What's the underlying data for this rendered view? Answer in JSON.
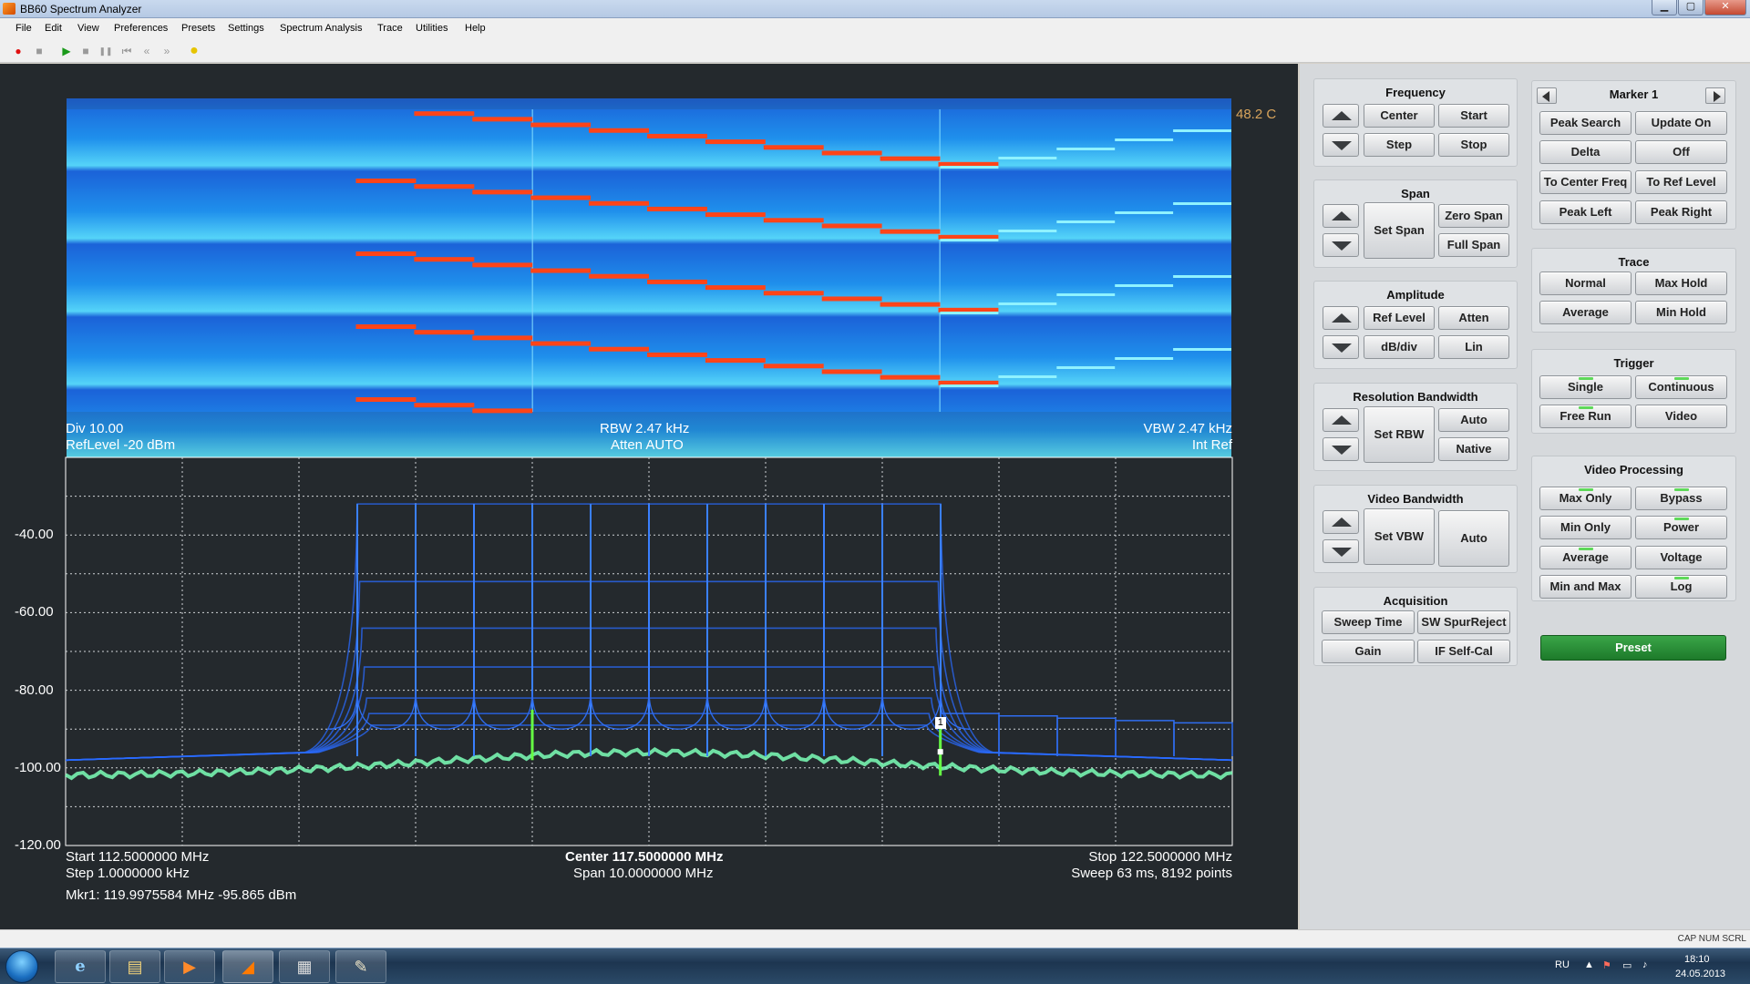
{
  "window": {
    "title": "BB60 Spectrum Analyzer"
  },
  "menu": [
    "File",
    "Edit",
    "View",
    "Preferences",
    "Presets",
    "Settings",
    "Spectrum Analysis",
    "Trace",
    "Utilities",
    "Help"
  ],
  "toolbar": {
    "record_icon": "●",
    "stop_rec_icon": "■",
    "play_icon": "▶",
    "stop_icon": "■",
    "pause_icon": "❚❚",
    "prev_icon": "⏮",
    "rewind_icon": "«",
    "forward_icon": "»",
    "cal_icon": "●"
  },
  "waterfall": {
    "temperature": "48.2 C"
  },
  "plot_info": {
    "div": "Div 10.00",
    "ref_level": "RefLevel -20 dBm",
    "rbw": "RBW 2.47 kHz",
    "atten": "Atten AUTO",
    "vbw": "VBW 2.47 kHz",
    "ref": "Int Ref",
    "start": "Start 112.5000000 MHz",
    "step": "Step 1.0000000 kHz",
    "center": "Center 117.5000000 MHz",
    "span": "Span 10.0000000 MHz",
    "stop": "Stop 122.5000000 MHz",
    "sweep": "Sweep 63 ms, 8192 points",
    "marker_readout": "Mkr1: 119.9975584 MHz -95.865 dBm",
    "marker_label": "1"
  },
  "chart_data": {
    "type": "line",
    "xlabel": "",
    "ylabel": "",
    "xlim": [
      112.5,
      122.5
    ],
    "ylim": [
      -120,
      -20
    ],
    "y_ticks": [
      "-40.00",
      "-60.00",
      "-80.00",
      "-100.00",
      "-120.00"
    ],
    "grid": true,
    "tone_spacing_mhz": 0.5,
    "tone_range_mhz": [
      115.0,
      120.0
    ],
    "tone_peak_dbm": -32,
    "noise_floor_dbm": -99,
    "marker": {
      "x": 119.9975584,
      "y": -95.865
    }
  },
  "controls": {
    "frequency": {
      "title": "Frequency",
      "center": "Center",
      "start": "Start",
      "step": "Step",
      "stop": "Stop"
    },
    "span": {
      "title": "Span",
      "set_span": "Set Span",
      "zero_span": "Zero Span",
      "full_span": "Full Span"
    },
    "amplitude": {
      "title": "Amplitude",
      "ref_level": "Ref Level",
      "atten": "Atten",
      "db_div": "dB/div",
      "lin": "Lin"
    },
    "rbw": {
      "title": "Resolution Bandwidth",
      "set_rbw": "Set RBW",
      "auto": "Auto",
      "native": "Native"
    },
    "vbw": {
      "title": "Video Bandwidth",
      "set_vbw": "Set VBW",
      "auto": "Auto"
    },
    "acquisition": {
      "title": "Acquisition",
      "sweep_time": "Sweep Time",
      "sw_spur": "SW SpurReject",
      "gain": "Gain",
      "if_cal": "IF Self-Cal"
    },
    "marker": {
      "title": "Marker 1",
      "peak_search": "Peak Search",
      "update_on": "Update On",
      "delta": "Delta",
      "off": "Off",
      "to_center": "To Center Freq",
      "to_ref": "To Ref Level",
      "peak_left": "Peak Left",
      "peak_right": "Peak Right"
    },
    "trace": {
      "title": "Trace",
      "normal": "Normal",
      "max_hold": "Max Hold",
      "average": "Average",
      "min_hold": "Min Hold"
    },
    "trigger": {
      "title": "Trigger",
      "single": "Single",
      "continuous": "Continuous",
      "free_run": "Free Run",
      "video": "Video"
    },
    "video_processing": {
      "title": "Video Processing",
      "max_only": "Max Only",
      "bypass": "Bypass",
      "min_only": "Min Only",
      "power": "Power",
      "average": "Average",
      "voltage": "Voltage",
      "min_max": "Min and Max",
      "log": "Log"
    },
    "preset": "Preset"
  },
  "status": "CAP  NUM  SCRL",
  "taskbar": {
    "lang": "RU",
    "time": "18:10",
    "date": "24.05.2013",
    "ie_icon": "e",
    "folder_icon": "▤",
    "media_icon": "▶",
    "app_icon": "◢",
    "device_icon": "▦",
    "paint_icon": "✎"
  },
  "colors": {
    "plot_bg": "#24292d",
    "waterfall_base": "#1a62d4",
    "trace": "#2a6bff",
    "trace_floor": "#7dffb8",
    "marker": "#66ff44",
    "waterfall_step": "#ff4418",
    "preset": "#1d7a2a"
  }
}
